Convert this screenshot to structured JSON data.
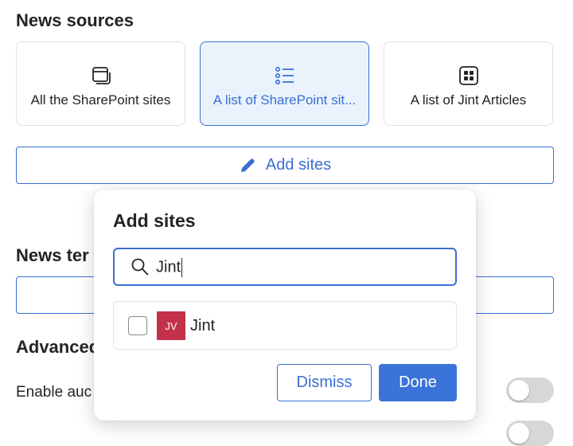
{
  "news_sources": {
    "title": "News sources",
    "options": [
      {
        "label": "All the SharePoint sites",
        "icon": "window-stack-icon",
        "selected": false
      },
      {
        "label": "A list of SharePoint sit...",
        "icon": "list-icon",
        "selected": true
      },
      {
        "label": "A list of Jint Articles",
        "icon": "grid-icon",
        "selected": false
      }
    ],
    "add_sites_label": "Add sites"
  },
  "news_template": {
    "title": "News ter"
  },
  "advanced": {
    "title": "Advanced",
    "enable_label": "Enable auc",
    "toggle_on": false
  },
  "popup": {
    "title": "Add sites",
    "search_value": "Jint",
    "results": [
      {
        "initials": "JV",
        "name": "Jint",
        "avatar_color": "#c4314b",
        "checked": false
      }
    ],
    "dismiss_label": "Dismiss",
    "done_label": "Done"
  },
  "colors": {
    "accent": "#3a6fd3",
    "selected_bg": "#eaf3fc",
    "avatar": "#c4314b"
  }
}
